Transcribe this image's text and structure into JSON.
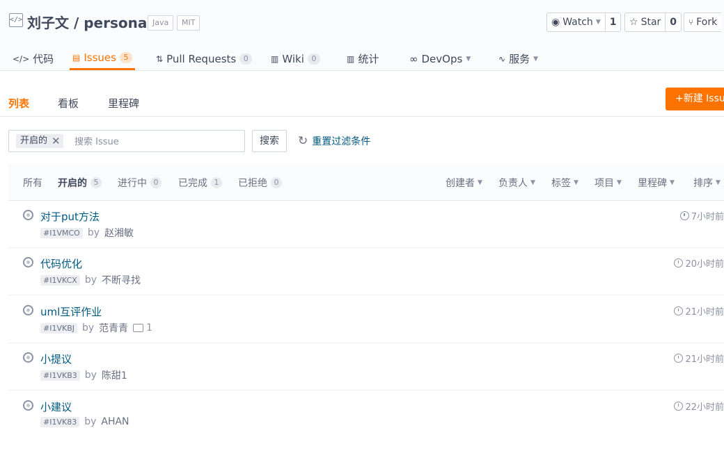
{
  "repo": {
    "owner_name": "刘子文 / personal",
    "lang_tag": "Java",
    "license_tag": "MIT"
  },
  "actions": {
    "watch": {
      "label": "Watch",
      "count": "1"
    },
    "star": {
      "label": "Star",
      "count": "0"
    },
    "fork": {
      "label": "Fork"
    }
  },
  "nav": {
    "code": "代码",
    "issues": "Issues",
    "issues_count": "5",
    "pulls": "Pull Requests",
    "pulls_count": "0",
    "wiki": "Wiki",
    "wiki_count": "0",
    "stats": "统计",
    "devops": "DevOps",
    "services": "服务"
  },
  "subnav": {
    "list": "列表",
    "board": "看板",
    "milestone": "里程碑",
    "new_issue": "+新建 Issue"
  },
  "filter": {
    "chip": "开启的",
    "search_placeholder": "搜索 Issue",
    "search_button": "搜索",
    "reset": "重置过滤条件"
  },
  "states": {
    "all": "所有",
    "open": "开启的",
    "open_count": "5",
    "progress": "进行中",
    "progress_count": "0",
    "done": "已完成",
    "done_count": "1",
    "rejected": "已拒绝",
    "rejected_count": "0"
  },
  "dropdowns": {
    "creator": "创建者",
    "assignee": "负责人",
    "label": "标签",
    "project": "项目",
    "milestone": "里程碑",
    "sort": "排序"
  },
  "issues": [
    {
      "title": "对于put方法",
      "id": "#I1VMCO",
      "by": "by",
      "author": "赵湘敏",
      "time": "7小时前"
    },
    {
      "title": "代码优化",
      "id": "#I1VKCX",
      "by": "by",
      "author": "不断寻找",
      "time": "20小时前"
    },
    {
      "title": "uml互评作业",
      "id": "#I1VKBJ",
      "by": "by",
      "author": "范青青",
      "comments": "1",
      "time": "21小时前"
    },
    {
      "title": "小提议",
      "id": "#I1VKB3",
      "by": "by",
      "author": "陈甜1",
      "time": "21小时前"
    },
    {
      "title": "小建议",
      "id": "#I1VK83",
      "by": "by",
      "author": "AHAN",
      "time": "22小时前"
    }
  ],
  "colors": {
    "accent": "#fe7300",
    "link": "#005980"
  }
}
